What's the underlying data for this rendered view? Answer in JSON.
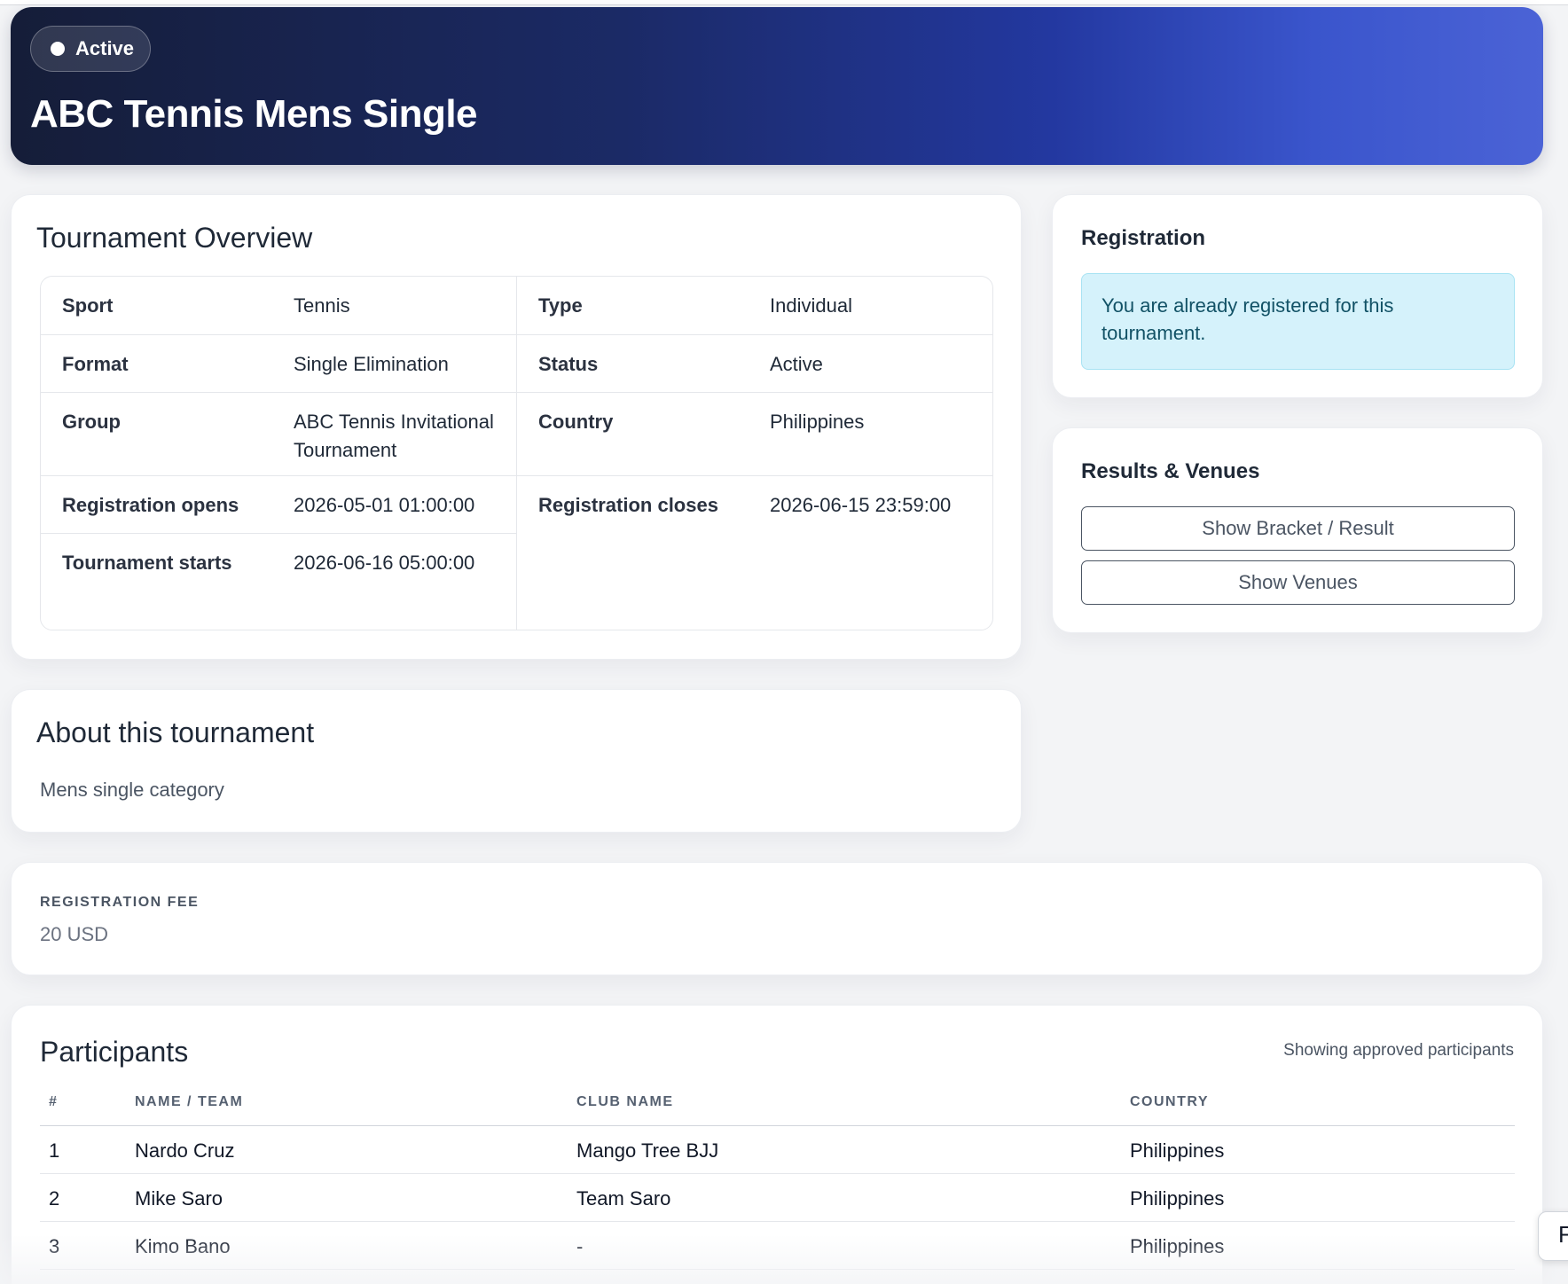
{
  "hero": {
    "status": "Active",
    "title": "ABC Tennis Mens Single"
  },
  "overview": {
    "heading": "Tournament Overview",
    "left": [
      {
        "label": "Sport",
        "value": "Tennis"
      },
      {
        "label": "Format",
        "value": "Single Elimination"
      },
      {
        "label": "Group",
        "value": "ABC Tennis Invitational Tournament"
      },
      {
        "label": "Registration opens",
        "value": "2026-05-01 01:00:00"
      },
      {
        "label": "Tournament starts",
        "value": "2026-06-16 05:00:00"
      }
    ],
    "right": [
      {
        "label": "Type",
        "value": "Individual"
      },
      {
        "label": "Status",
        "value": "Active"
      },
      {
        "label": "Country",
        "value": "Philippines"
      },
      {
        "label": "Registration closes",
        "value": "2026-06-15 23:59:00"
      }
    ]
  },
  "about": {
    "heading": "About this tournament",
    "text": "Mens single category"
  },
  "registration": {
    "heading": "Registration",
    "message": "You are already registered for this tournament."
  },
  "results": {
    "heading": "Results & Venues",
    "bracket_button": "Show Bracket / Result",
    "venues_button": "Show Venues"
  },
  "fee": {
    "label": "REGISTRATION FEE",
    "value": "20 USD"
  },
  "participants": {
    "heading": "Participants",
    "note": "Showing approved participants",
    "columns": [
      "#",
      "NAME / TEAM",
      "CLUB NAME",
      "COUNTRY"
    ],
    "rows": [
      [
        "1",
        "Nardo Cruz",
        "Mango Tree BJJ",
        "Philippines"
      ],
      [
        "2",
        "Mike Saro",
        "Team Saro",
        "Philippines"
      ],
      [
        "3",
        "Kimo Bano",
        "-",
        "Philippines"
      ]
    ]
  },
  "edge_tab": {
    "label": "F"
  }
}
